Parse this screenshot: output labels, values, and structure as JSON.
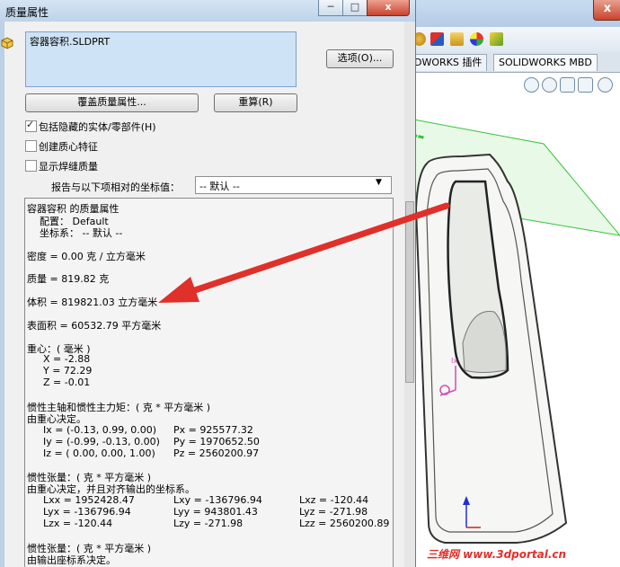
{
  "dialog": {
    "title": "质量属性",
    "filename": "容器容积.SLDPRT",
    "options_label": "选项(O)...",
    "override_label": "覆盖质量属性...",
    "recalc_label": "重算(R)",
    "checkboxes": [
      {
        "label": "包括隐藏的实体/零部件(H)",
        "checked": true
      },
      {
        "label": "创建质心特征",
        "checked": false
      },
      {
        "label": "显示焊缝质量",
        "checked": false
      }
    ],
    "ref_label": "报告与以下项相对的坐标值：",
    "ref_value": "-- 默认 --"
  },
  "results": {
    "heading": "容器容积 的质量属性",
    "config": "配置： Default",
    "coord": "坐标系： -- 默认 --",
    "density": "密度 = 0.00 克 / 立方毫米",
    "mass": "质量 = 819.82 克",
    "volume": "体积 = 819821.03 立方毫米",
    "surface": "表面积 = 60532.79  平方毫米",
    "cog_heading": "重心：( 毫米 )",
    "cog_x": "X = -2.88",
    "cog_y": "Y = 72.29",
    "cog_z": "Z = -0.01",
    "principal_heading": "惯性主轴和惯性主力矩：( 克 *  平方毫米 )",
    "principal_sub": "由重心决定。",
    "ix": "Ix = (-0.13,  0.99,  0.00)",
    "iy": "Iy = (-0.99, -0.13,  0.00)",
    "iz": "Iz = ( 0.00,  0.00,  1.00)",
    "px": "Px = 925577.32",
    "py": "Py = 1970652.50",
    "pz": "Pz = 2560200.97",
    "tensor_heading": "惯性张量：( 克 *  平方毫米 )",
    "tensor_sub": "由重心决定，并且对齐输出的坐标系。",
    "lxx": "Lxx = 1952428.47",
    "lxy": "Lxy = -136796.94",
    "lxz": "Lxz = -120.44",
    "lyx": "Lyx = -136796.94",
    "lyy": "Lyy = 943801.43",
    "lyz": "Lyz = -271.98",
    "lzx": "Lzx = -120.44",
    "lzy": "Lzy = -271.98",
    "lzz": "Lzz = 2560200.89",
    "tensor2_heading": "惯性张量：( 克 *  平方毫米 )",
    "tensor2_sub": "由输出座标系决定。"
  },
  "background": {
    "tab_addins": "DWORKS 插件",
    "tab_mbd": "SOLIDWORKS MBD",
    "close_glyph": "x",
    "watermark": "三维网 www.3dportal.cn"
  },
  "caption_buttons": {
    "minimize": "─",
    "maximize": "□",
    "close": "x"
  },
  "colors": {
    "accent_arrow": "#e0302a",
    "selection": "#cfe3f6"
  }
}
